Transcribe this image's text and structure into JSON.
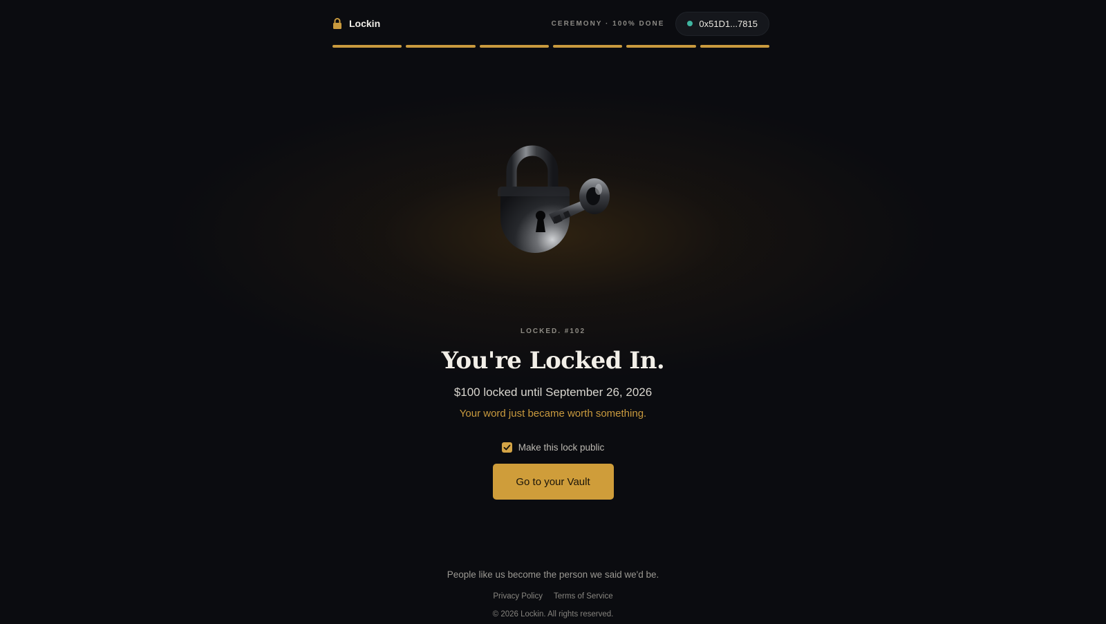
{
  "header": {
    "brand_name": "Lockin",
    "ceremony_status": "CEREMONY · 100% DONE",
    "wallet_address": "0x51D1...7815"
  },
  "progress": {
    "segments_total": 6,
    "segments_complete": 6,
    "accent_color": "#c99a3e"
  },
  "hero": {
    "icon": "padlock-with-key-icon"
  },
  "confirmation": {
    "locked_label": "LOCKED. #102",
    "title": "You're Locked In.",
    "amount_text": "$100 locked until September 26, 2026",
    "tagline": "Your word just became worth something.",
    "public_checkbox_label": "Make this lock public",
    "public_checked": true,
    "cta_label": "Go to your Vault"
  },
  "footer": {
    "motto": "People like us become the person we said we'd be.",
    "privacy_link": "Privacy Policy",
    "terms_link": "Terms of Service",
    "copyright": "© 2026 Lockin. All rights reserved."
  },
  "colors": {
    "background": "#0b0c10",
    "gold": "#cf9d3a",
    "wallet_status": "#3fb5a0"
  }
}
